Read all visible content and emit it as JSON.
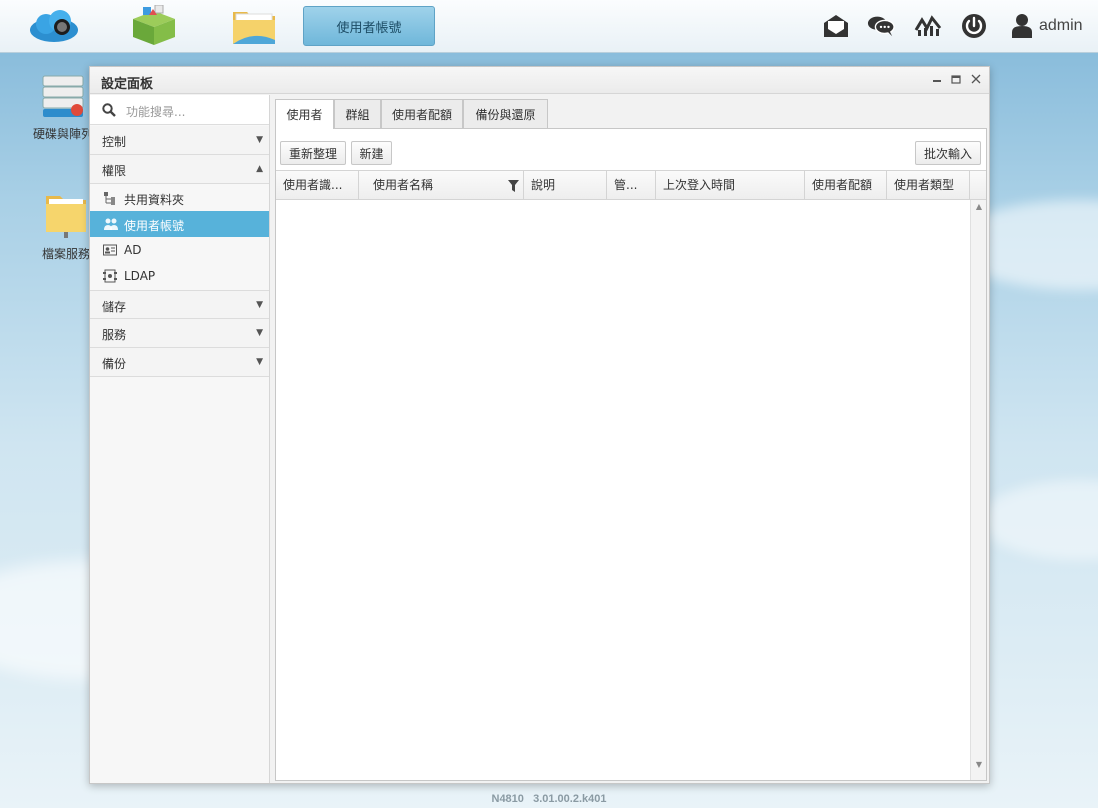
{
  "topbar": {
    "apps": [
      {
        "name": "cloud-app-icon"
      },
      {
        "name": "package-app-icon"
      },
      {
        "name": "folder-app-icon"
      }
    ],
    "active_app": "使用者帳號",
    "user": "admin"
  },
  "desktop": {
    "icons": [
      {
        "label": "硬碟與陣列"
      },
      {
        "label": "檔案服務"
      }
    ]
  },
  "window": {
    "title": "設定面板"
  },
  "sidebar": {
    "search_placeholder": "功能搜尋...",
    "sections": [
      {
        "label": "控制"
      },
      {
        "label": "權限"
      },
      {
        "label": "儲存"
      },
      {
        "label": "服務"
      },
      {
        "label": "備份"
      }
    ],
    "items": [
      {
        "label": "共用資料夾"
      },
      {
        "label": "使用者帳號"
      },
      {
        "label": "AD"
      },
      {
        "label": "LDAP"
      }
    ]
  },
  "tabs": [
    {
      "label": "使用者"
    },
    {
      "label": "群組"
    },
    {
      "label": "使用者配額"
    },
    {
      "label": "備份與還原"
    }
  ],
  "toolbar": {
    "refresh": "重新整理",
    "new": "新建",
    "batch": "批次輸入"
  },
  "grid": {
    "columns": [
      "使用者識...",
      "使用者名稱",
      "說明",
      "管...",
      "上次登入時間",
      "使用者配額",
      "使用者類型"
    ]
  },
  "footer": {
    "model": "N4810",
    "version": "3.01.00.2.k401"
  },
  "colors": {
    "accent": "#57b2da",
    "active_tab": "#6fb7da"
  }
}
